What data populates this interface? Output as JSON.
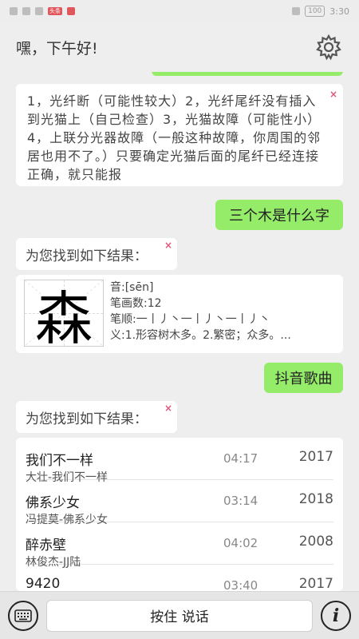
{
  "status_bar": {
    "time": "3:30",
    "battery": "100"
  },
  "header": {
    "greeting": "嘿，下午好!",
    "settings_icon": "gear-icon"
  },
  "messages": {
    "answer_text": "1，光纤断（可能性较大）2，光纤尾纤没有插入到光猫上（自己检查）3，光猫故障（可能性小）4，上联分光器故障（一般这种故障，你周围的邻居也用不了。）只要确定光猫后面的尾纤已经连接正确，就只能报",
    "query1": "三个木是什么字",
    "found_label_1": "为您找到如下结果：",
    "char": {
      "glyph": "森",
      "pinyin": "音:[sēn]",
      "strokes": "笔画数:12",
      "order": "笔顺:一丨丿丶一丨丿丶一丨丿丶",
      "meaning": "义:1.形容树木多。2.繁密；众多。..."
    },
    "query2": "抖音歌曲",
    "found_label_2": "为您找到如下结果：",
    "close_mark": "×",
    "songs": [
      {
        "title": "我们不一样",
        "sub": "大壮-我们不一样",
        "duration": "04:17",
        "year": "2017"
      },
      {
        "title": "佛系少女",
        "sub": "冯提莫-佛系少女",
        "duration": "03:14",
        "year": "2018"
      },
      {
        "title": "醉赤壁",
        "sub": "林俊杰-JJ陆",
        "duration": "04:02",
        "year": "2008"
      },
      {
        "title": "9420",
        "sub": "",
        "duration": "03:40",
        "year": "2017"
      }
    ]
  },
  "bottom_bar": {
    "talk_label": "按住 说话",
    "info_label": "i"
  }
}
